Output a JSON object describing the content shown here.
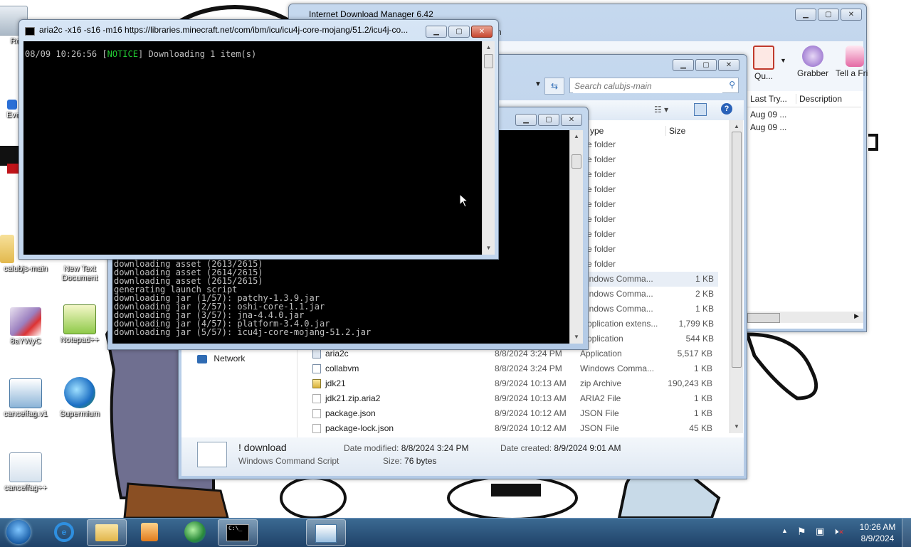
{
  "desktop": {
    "icons": [
      {
        "label": "Rec"
      },
      {
        "label": "Eve"
      },
      {
        "label": "calubjs-main"
      },
      {
        "label": "New Text Document"
      },
      {
        "label": "8aYWyC"
      },
      {
        "label": "Notepad++"
      },
      {
        "label": "cancelfag.v1"
      },
      {
        "label": "Supermium"
      },
      {
        "label": "cancelfag++"
      }
    ]
  },
  "idm": {
    "title": "Internet Download Manager 6.42",
    "menu_fragment": "n",
    "toolbar": {
      "queue": "Qu...",
      "grabber": "Grabber",
      "tell_friend": "Tell a Fri"
    },
    "columns": [
      "Last Try...",
      "Description"
    ],
    "rows": [
      {
        "last_try": "Aug 09 ..."
      },
      {
        "last_try": "Aug 09 ..."
      }
    ]
  },
  "explorer": {
    "search_placeholder": "Search calubjs-main",
    "columns": {
      "type": "ype",
      "size": "Size"
    },
    "nav_network": "Network",
    "rows_partial": [
      {
        "type": "e folder",
        "size": ""
      },
      {
        "type": "e folder",
        "size": ""
      },
      {
        "type": "e folder",
        "size": ""
      },
      {
        "type": "e folder",
        "size": ""
      },
      {
        "type": "e folder",
        "size": ""
      },
      {
        "type": "e folder",
        "size": ""
      },
      {
        "type": "e folder",
        "size": ""
      },
      {
        "type": "e folder",
        "size": ""
      },
      {
        "type": "e folder",
        "size": ""
      },
      {
        "type": "indows Comma...",
        "size": "1 KB"
      },
      {
        "type": "indows Comma...",
        "size": "2 KB"
      },
      {
        "type": "indows Comma...",
        "size": "1 KB"
      },
      {
        "type": "pplication extens...",
        "size": "1,799 KB"
      },
      {
        "type": "pplication",
        "size": "544 KB"
      }
    ],
    "rows_full": [
      {
        "name": "aria2c",
        "date": "8/8/2024 3:24 PM",
        "type": "Application",
        "size": "5,517 KB",
        "icon": "app-icon"
      },
      {
        "name": "collabvm",
        "date": "8/8/2024 3:24 PM",
        "type": "Windows Comma...",
        "size": "1 KB",
        "icon": "script-icon"
      },
      {
        "name": "jdk21",
        "date": "8/9/2024 10:13 AM",
        "type": "zip Archive",
        "size": "190,243 KB",
        "icon": "zip-icon"
      },
      {
        "name": "jdk21.zip.aria2",
        "date": "8/9/2024 10:13 AM",
        "type": "ARIA2 File",
        "size": "1 KB",
        "icon": "file-icon"
      },
      {
        "name": "package.json",
        "date": "8/9/2024 10:12 AM",
        "type": "JSON File",
        "size": "1 KB",
        "icon": "file-icon"
      },
      {
        "name": "package-lock.json",
        "date": "8/9/2024 10:12 AM",
        "type": "JSON File",
        "size": "45 KB",
        "icon": "file-icon"
      }
    ],
    "details": {
      "name": "! download",
      "kind": "Windows Command Script",
      "modified_label": "Date modified:",
      "modified": "8/8/2024 3:24 PM",
      "created_label": "Date created:",
      "created": "8/9/2024 9:01 AM",
      "size_label": "Size:",
      "size": "76 bytes"
    }
  },
  "console_back": {
    "lines": [
      "downloading asset (2613/2615)",
      "downloading asset (2614/2615)",
      "downloading asset (2615/2615)",
      "generating launch script",
      "downloading jar (1/57): patchy-1.3.9.jar",
      "downloading jar (2/57): oshi-core-1.1.jar",
      "downloading jar (3/57): jna-4.4.0.jar",
      "downloading jar (4/57): platform-3.4.0.jar",
      "downloading jar (5/57): icu4j-core-mojang-51.2.jar"
    ]
  },
  "console_front": {
    "title": "aria2c  -x16 -s16 -m16 https://libraries.minecraft.net/com/ibm/icu/icu4j-core-mojang/51.2/icu4j-co...",
    "timestamp": "08/09 10:26:56",
    "notice_open": "[",
    "notice": "NOTICE",
    "notice_close": "]",
    "message": "Downloading 1 item(s)"
  },
  "taskbar": {
    "time": "10:26 AM",
    "date": "8/9/2024",
    "cmd_label": "C:\\_"
  },
  "colors": {
    "notice_green": "#22cc33",
    "taskbar_top": "#3b6a92",
    "taskbar_bottom": "#1f4268"
  }
}
